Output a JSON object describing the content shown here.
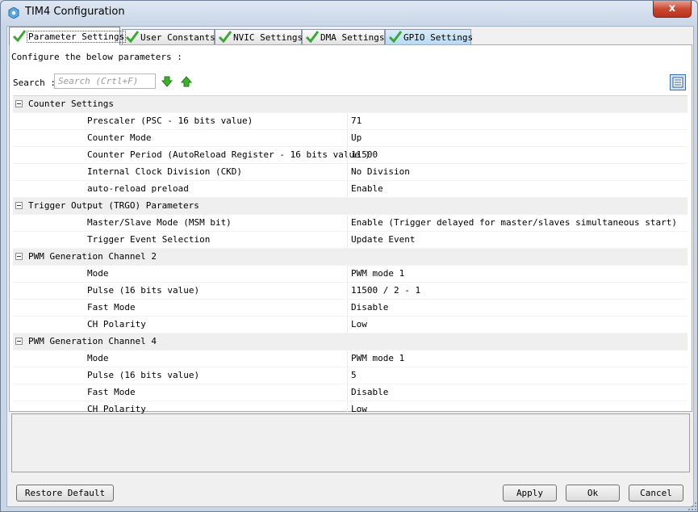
{
  "window": {
    "title": "TIM4 Configuration",
    "close_label": "x"
  },
  "tabs": [
    {
      "label": "Parameter Settings",
      "active": true
    },
    {
      "label": "User Constants"
    },
    {
      "label": "NVIC Settings"
    },
    {
      "label": "DMA Settings"
    },
    {
      "label": "GPIO Settings"
    }
  ],
  "panel": {
    "instructions": "Configure the below parameters :",
    "search_label": "Search :",
    "search_placeholder": "Search (Crtl+F)"
  },
  "groups": [
    {
      "title": "Counter Settings",
      "params": [
        {
          "name": "Prescaler (PSC - 16 bits value)",
          "value": "71"
        },
        {
          "name": "Counter Mode",
          "value": "Up"
        },
        {
          "name": "Counter Period (AutoReload Register - 16 bits value )",
          "value": "11500"
        },
        {
          "name": "Internal Clock Division (CKD)",
          "value": "No Division"
        },
        {
          "name": "auto-reload preload",
          "value": "Enable"
        }
      ]
    },
    {
      "title": "Trigger Output (TRGO) Parameters",
      "params": [
        {
          "name": "Master/Slave Mode (MSM bit)",
          "value": "Enable (Trigger delayed for master/slaves simultaneous start)"
        },
        {
          "name": "Trigger Event Selection",
          "value": "Update Event"
        }
      ]
    },
    {
      "title": "PWM Generation Channel 2",
      "params": [
        {
          "name": "Mode",
          "value": "PWM mode 1"
        },
        {
          "name": "Pulse (16 bits value)",
          "value": "11500 / 2 - 1"
        },
        {
          "name": "Fast Mode",
          "value": "Disable"
        },
        {
          "name": "CH Polarity",
          "value": "Low"
        }
      ]
    },
    {
      "title": "PWM Generation Channel 4",
      "params": [
        {
          "name": "Mode",
          "value": "PWM mode 1"
        },
        {
          "name": "Pulse (16 bits value)",
          "value": "5"
        },
        {
          "name": "Fast Mode",
          "value": "Disable"
        },
        {
          "name": "CH Polarity",
          "value": "Low"
        }
      ]
    }
  ],
  "buttons": {
    "restore_default": "Restore Default",
    "apply": "Apply",
    "ok": "Ok",
    "cancel": "Cancel"
  },
  "icons": {
    "tab_check": "check-icon",
    "search_next": "arrow-down-icon",
    "search_prev": "arrow-up-icon",
    "list_view": "list-view-icon",
    "app": "gear-icon"
  },
  "colors": {
    "check_green": "#3aa832",
    "window_frame": "#c9d6e6",
    "selected_tab_gpio": "#b9d9f1"
  }
}
